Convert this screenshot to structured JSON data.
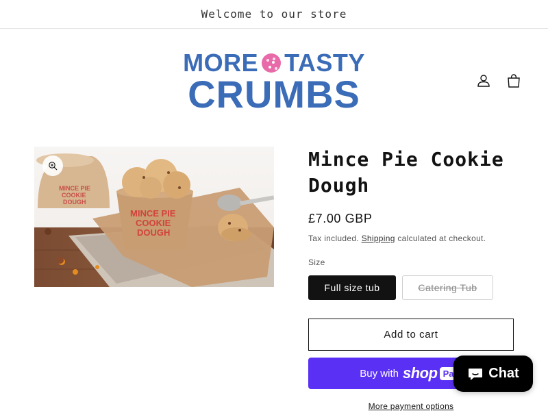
{
  "announcement": {
    "text": "Welcome to our store"
  },
  "logo": {
    "line1_left": "MORE",
    "line1_right": "TASTY",
    "line2": "CRUMBS"
  },
  "header": {
    "account_icon": "person-icon",
    "cart_icon": "bag-icon"
  },
  "gallery": {
    "zoom_icon": "zoom-in-icon",
    "image_label_text": [
      "MINCE PIE",
      "COOKIE",
      "DOUGH"
    ]
  },
  "product": {
    "title": "Mince Pie Cookie Dough",
    "price": "£7.00 GBP",
    "tax_prefix": "Tax included.",
    "shipping_link": "Shipping",
    "tax_suffix": "calculated at checkout.",
    "size_label": "Size",
    "size_options": [
      "Full size tub",
      "Catering Tub"
    ],
    "selected_size": "Full size tub",
    "add_to_cart": "Add to cart",
    "buy_with": "Buy with",
    "shop_brand": "shop",
    "pay_label": "Pay",
    "more_payment": "More payment options"
  },
  "chat": {
    "label": "Chat",
    "icon": "chat-bubble-icon"
  },
  "colors": {
    "brand_blue": "#3b6cb7",
    "cookie_pink": "#e86aa8",
    "shop_pay_purple": "#5a31f4",
    "dark": "#121212"
  }
}
